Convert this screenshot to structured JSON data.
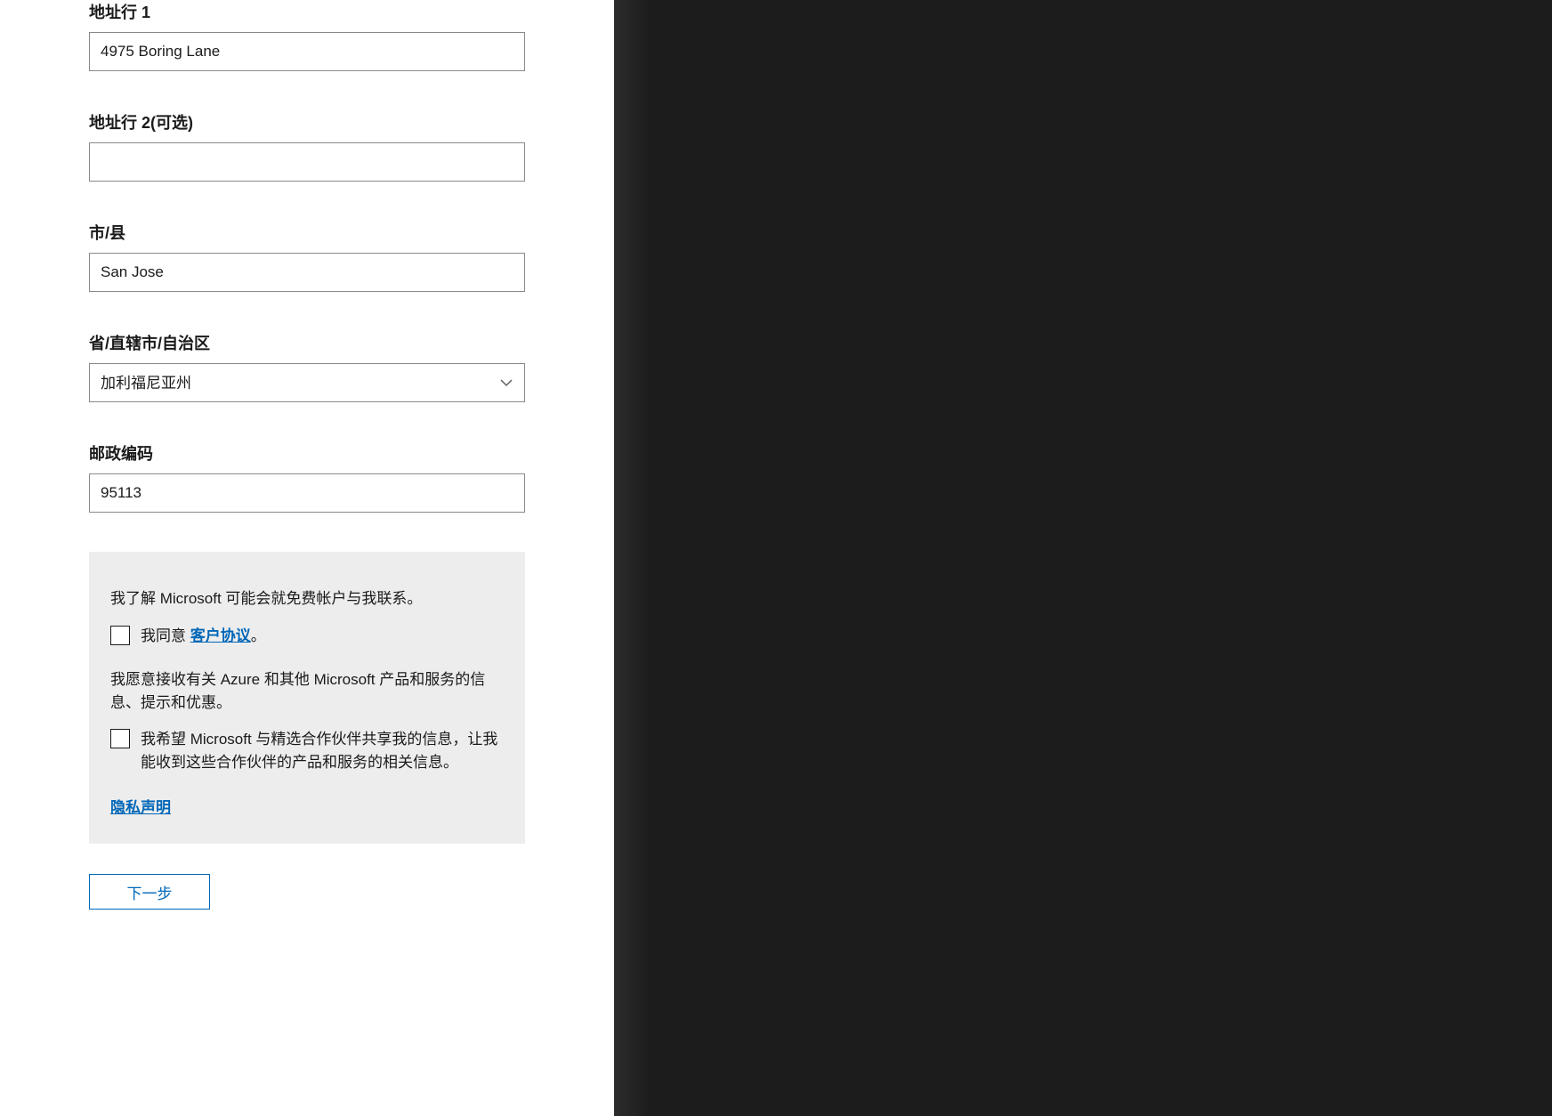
{
  "fields": {
    "address1": {
      "label": "地址行 1",
      "value": "4975 Boring Lane"
    },
    "address2": {
      "label": "地址行 2(可选)",
      "value": ""
    },
    "city": {
      "label": "市/县",
      "value": "San Jose"
    },
    "state": {
      "label": "省/直辖市/自治区",
      "value": "加利福尼亚州"
    },
    "postal": {
      "label": "邮政编码",
      "value": "95113"
    }
  },
  "agreement": {
    "contact_notice": "我了解 Microsoft 可能会就免费帐户与我联系。",
    "agree_prefix": "我同意 ",
    "agreement_link": "客户协议",
    "agree_suffix": "。",
    "marketing_notice": "我愿意接收有关 Azure 和其他 Microsoft 产品和服务的信息、提示和优惠。",
    "share_partners": "我希望 Microsoft 与精选合作伙伴共享我的信息，让我能收到这些合作伙伴的产品和服务的相关信息。",
    "privacy_link": "隐私声明"
  },
  "buttons": {
    "next": "下一步"
  }
}
